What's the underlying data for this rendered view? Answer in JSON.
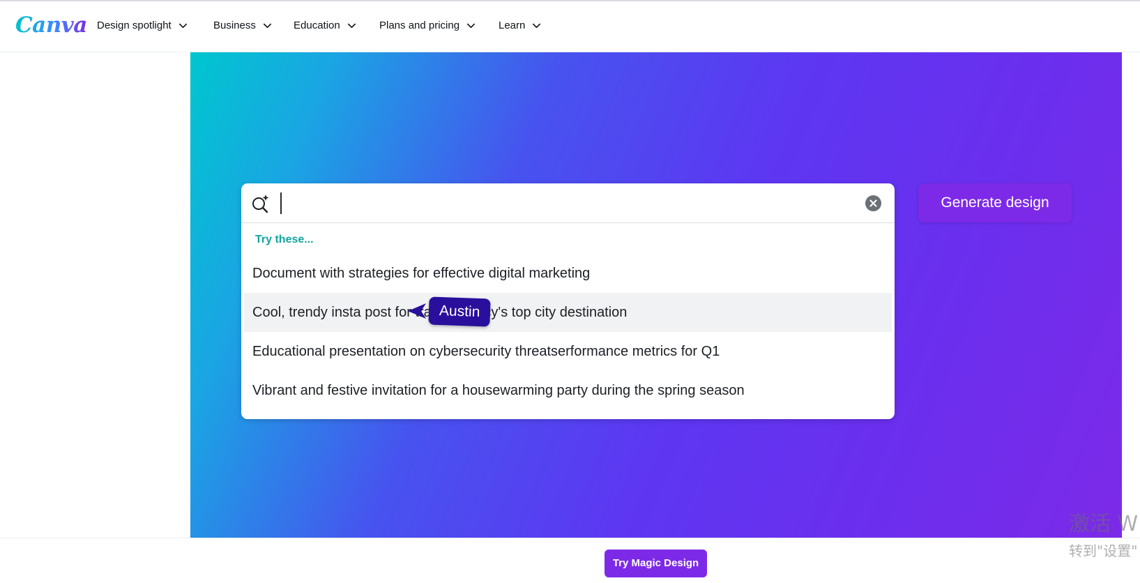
{
  "brand": {
    "logo_text": "Canva"
  },
  "nav": {
    "items": [
      {
        "label": "Design spotlight"
      },
      {
        "label": "Business"
      },
      {
        "label": "Education"
      },
      {
        "label": "Plans and pricing"
      },
      {
        "label": "Learn"
      }
    ]
  },
  "search": {
    "value": "",
    "placeholder": "",
    "suggestions_heading": "Try these...",
    "suggestions": [
      "Document with strategies for effective digital marketing",
      "Cool, trendy insta post for travel agency's top city destination",
      "Educational presentation on cybersecurity threatserformance metrics for Q1",
      "Vibrant and festive invitation for a housewarming party during the spring season"
    ],
    "highlighted_index": 1
  },
  "collaborator_cursor": {
    "name": "Austin",
    "color": "#2a0f9c"
  },
  "actions": {
    "generate_label": "Generate design",
    "try_magic_label": "Try Magic Design"
  },
  "watermark": {
    "line1": "激活 W",
    "line2": "转到\"设置\""
  },
  "colors": {
    "accent_purple": "#7d2ae8",
    "teal_heading": "#13a59d",
    "hero_gradient_start": "#00c6cf",
    "hero_gradient_end": "#7c2ae8"
  },
  "icons": {
    "search": "magic-search-icon",
    "clear": "clear-circle-x-icon",
    "dropdown": "chevron-down-icon",
    "cursor": "pointer-arrow-icon"
  }
}
